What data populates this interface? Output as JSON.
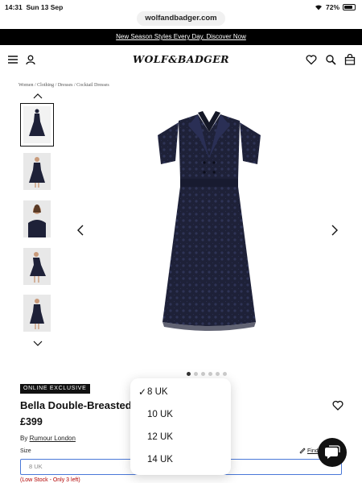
{
  "status_bar": {
    "time": "14:31",
    "date": "Sun 13 Sep",
    "battery": "72%"
  },
  "browser": {
    "url": "wolfandbadger.com"
  },
  "promo_banner": {
    "text": "New Season Styles Every Day. Discover Now"
  },
  "header": {
    "logo": "WOLF&BADGER",
    "icons": [
      "menu-icon",
      "account-icon",
      "heart-icon",
      "search-icon",
      "bag-icon"
    ]
  },
  "breadcrumb": {
    "text": "Women / Clothing / Dresses / Cocktail Dresses"
  },
  "gallery": {
    "thumbnail_count": 5,
    "selected_thumbnail": 1,
    "dot_count": 6,
    "active_dot": 1
  },
  "product": {
    "badge": "ONLINE EXCLUSIVE",
    "title": "Bella Double-Breasted",
    "price": "£399",
    "by_prefix": "By",
    "brand": "Rumour London",
    "size_label": "Size",
    "find_size_link": "Find",
    "size_value": "8 UK",
    "stock_note": "(Low Stock - Only 3 left)"
  },
  "size_dropdown": {
    "selected_check": "✓",
    "options": [
      "8 UK",
      "10 UK",
      "12 UK",
      "14 UK"
    ],
    "selected_index": 0
  },
  "colors": {
    "dress": "#1e2138",
    "accent_border": "#4a78d8",
    "stock_red": "#b10000"
  }
}
